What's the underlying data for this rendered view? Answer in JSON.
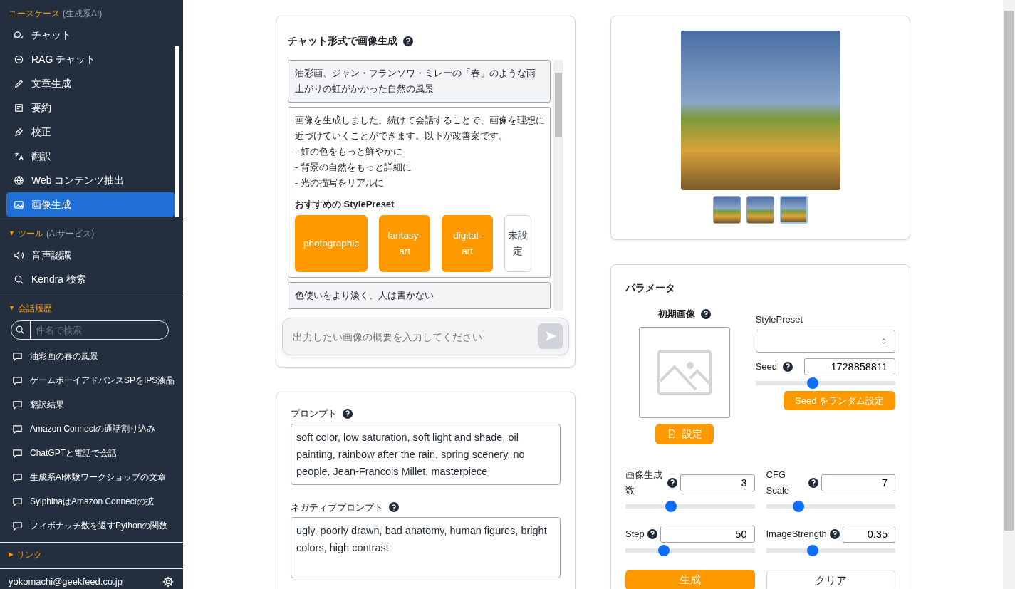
{
  "sidebar": {
    "sections": [
      {
        "title": "ユースケース",
        "subtitle": "(生成系AI)",
        "items": [
          {
            "label": "チャット",
            "selected": false
          },
          {
            "label": "RAG チャット",
            "selected": false
          },
          {
            "label": "文章生成",
            "selected": false
          },
          {
            "label": "要約",
            "selected": false
          },
          {
            "label": "校正",
            "selected": false
          },
          {
            "label": "翻訳",
            "selected": false
          },
          {
            "label": "Web コンテンツ抽出",
            "selected": false
          },
          {
            "label": "画像生成",
            "selected": true
          }
        ]
      },
      {
        "title": "ツール",
        "subtitle": "(AIサービス)",
        "caret": "▼",
        "items": [
          {
            "label": "音声認識",
            "selected": false
          },
          {
            "label": "Kendra 検索",
            "selected": false
          }
        ]
      },
      {
        "title": "会話履歴",
        "caret": "▼",
        "search_placeholder": "件名で検索",
        "items": [
          {
            "label": "油彩画の春の風景",
            "selected": false
          },
          {
            "label": "ゲームボーイアドバンスSPをIPS液晶",
            "selected": false
          },
          {
            "label": "翻訳結果",
            "selected": false
          },
          {
            "label": "Amazon Connectの通話割り込み",
            "selected": false
          },
          {
            "label": "ChatGPTと電話で会話",
            "selected": false
          },
          {
            "label": "生成系AI体験ワークショップの文章",
            "selected": false
          },
          {
            "label": "SylphinaはAmazon Connectの拡",
            "selected": false
          },
          {
            "label": "フィボナッチ数を返すPythonの関数",
            "selected": false
          }
        ]
      },
      {
        "title": "リンク",
        "caret": "▶"
      }
    ],
    "user": "yokomachi@geekfeed.co.jp"
  },
  "chat": {
    "title": "チャット形式で画像生成",
    "messages": [
      {
        "kind": "user",
        "text": "油彩画、ジャン・フランソワ・ミレーの「春」のような雨上がりの虹がかかった自然の風景"
      },
      {
        "kind": "assistant",
        "text": "画像を生成しました。続けて会話することで、画像を理想に近づけていくことができます。以下が改善案です。\n- 虹の色をもっと鮮やかに\n- 背景の自然をもっと詳細に\n- 光の描写をリアルに",
        "presets_title": "おすすめの StylePreset",
        "presets": [
          {
            "label": "photographic",
            "kind": "preset"
          },
          {
            "label": "fantasy-art",
            "kind": "preset"
          },
          {
            "label": "digital-art",
            "kind": "preset"
          },
          {
            "label": "未設定",
            "kind": "unset"
          }
        ]
      },
      {
        "kind": "user",
        "text": "色使いをより淡く、人は書かない"
      }
    ],
    "input_placeholder": "出力したい画像の概要を入力してください"
  },
  "prompts": {
    "prompt_label": "プロンプト",
    "prompt": "soft color, low saturation, soft light and shade, oil painting, rainbow after the rain, spring scenery, no people, Jean-Francois Millet, masterpiece",
    "negative_label": "ネガティブプロンプト",
    "negative": "ugly, poorly drawn, bad anatomy, human figures, bright colors, high contrast"
  },
  "gallery": {
    "thumbnails": [
      {
        "selected": false
      },
      {
        "selected": false
      },
      {
        "selected": true
      }
    ]
  },
  "parameters": {
    "title": "パラメータ",
    "initial_image_label": "初期画像",
    "set_button": "設定",
    "style_preset_label": "StylePreset",
    "seed_label": "Seed",
    "seed": "1728858811",
    "seed_slider": {
      "level": 0.41
    },
    "random_seed_button": "Seed をランダム設定",
    "sliders": [
      {
        "label": "画像生成数",
        "value": "3",
        "level": 0.35
      },
      {
        "label": "CFG Scale",
        "value": "7",
        "level": 0.25
      },
      {
        "label": "Step",
        "value": "50",
        "level": 0.3
      },
      {
        "label": "ImageStrength",
        "value": "0.35",
        "level": 0.36
      }
    ],
    "generate_button": "生成",
    "clear_button": "クリア"
  }
}
